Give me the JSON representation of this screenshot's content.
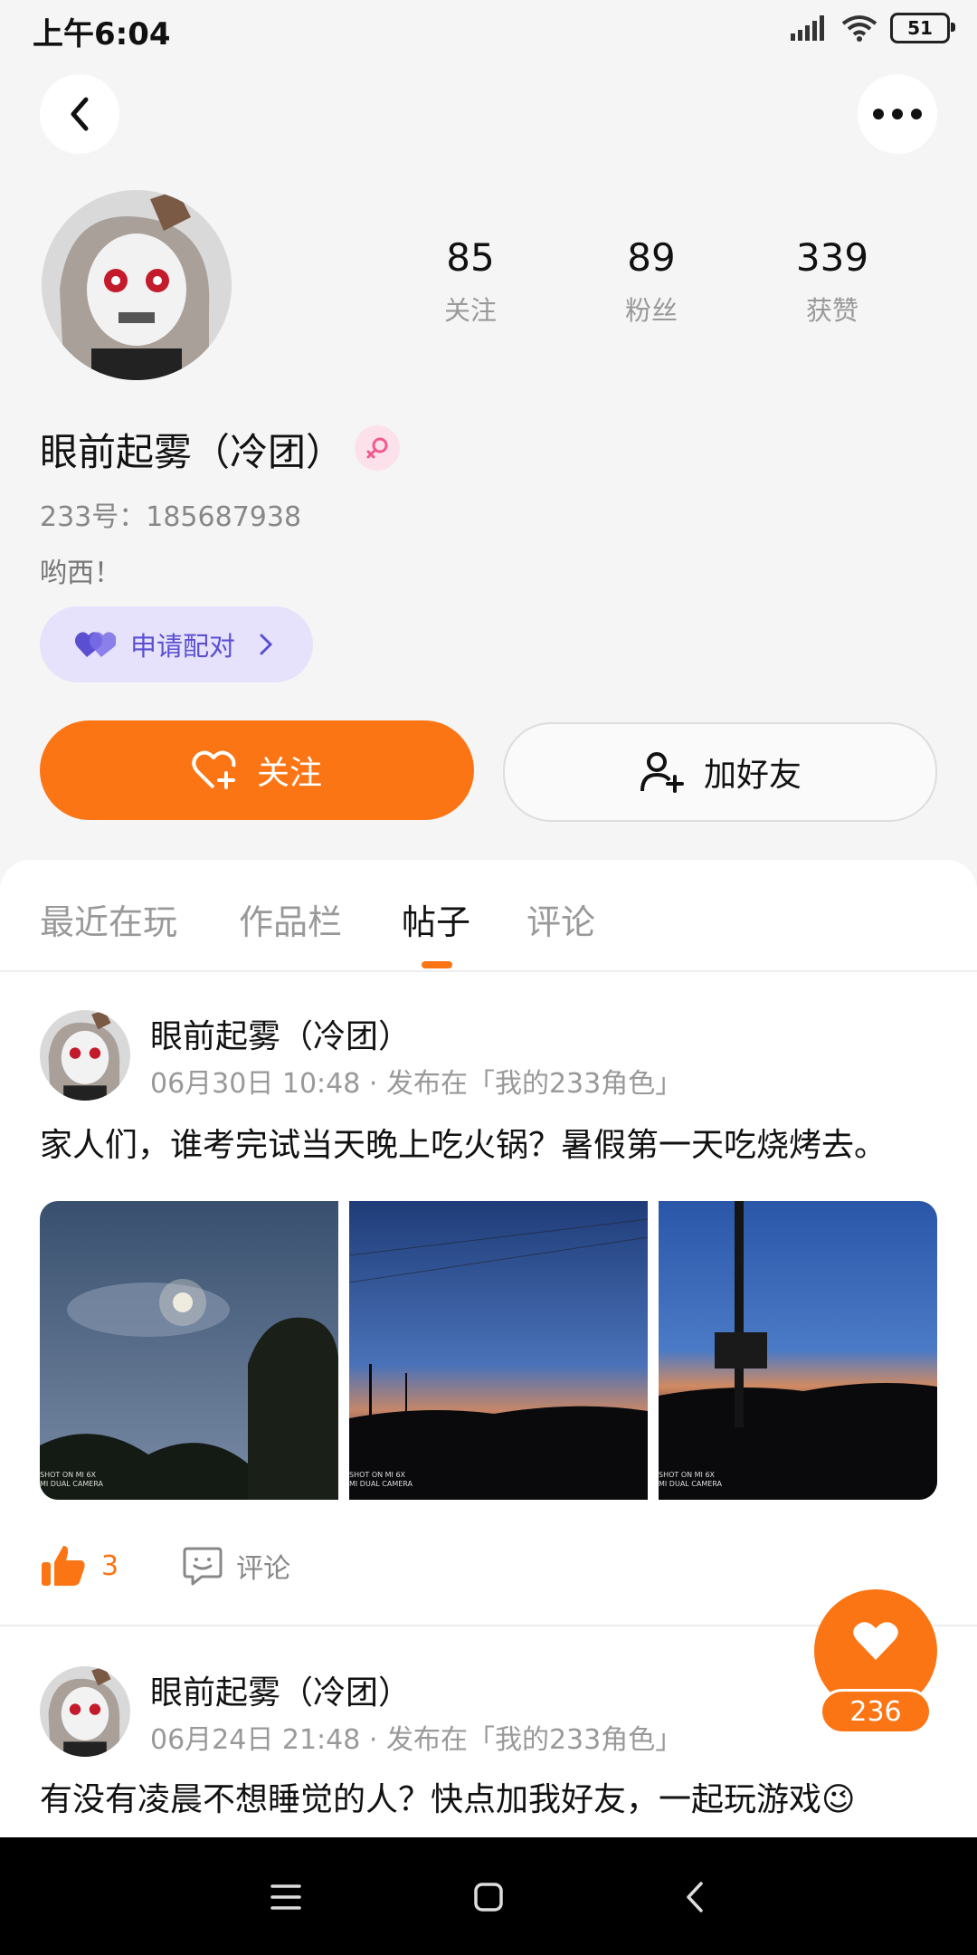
{
  "status_bar": {
    "time": "上午6:04",
    "battery": "51"
  },
  "profile": {
    "stats": [
      {
        "value": "85",
        "label": "关注"
      },
      {
        "value": "89",
        "label": "粉丝"
      },
      {
        "value": "339",
        "label": "获赞"
      }
    ],
    "nickname": "眼前起雾（冷团）",
    "uid": "233号：185687938",
    "bio": "哟西！",
    "pair_label": "申请配对",
    "follow_label": "关注",
    "add_friend_label": "加好友"
  },
  "tabs": [
    {
      "label": "最近在玩",
      "active": false
    },
    {
      "label": "作品栏",
      "active": false
    },
    {
      "label": "帖子",
      "active": true
    },
    {
      "label": "评论",
      "active": false
    }
  ],
  "posts": [
    {
      "author": "眼前起雾（冷团）",
      "meta": "06月30日 10:48 · 发布在「我的233角色」",
      "text": "家人们，谁考完试当天晚上吃火锅？暑假第一天吃烧烤去。",
      "photo_caption_line1": "SHOT ON MI 6X",
      "photo_caption_line2": "MI DUAL CAMERA",
      "like_count": "3",
      "comment_label": "评论"
    },
    {
      "author": "眼前起雾（冷团）",
      "meta": "06月24日 21:48 · 发布在「我的233角色」",
      "text": "有没有凌晨不想睡觉的人？快点加我好友，一起玩游戏😉"
    }
  ],
  "fab": {
    "count": "236"
  },
  "colors": {
    "accent": "#fc7515",
    "pair_bg": "#e6e2fb",
    "pair_text": "#5b4fd1"
  }
}
